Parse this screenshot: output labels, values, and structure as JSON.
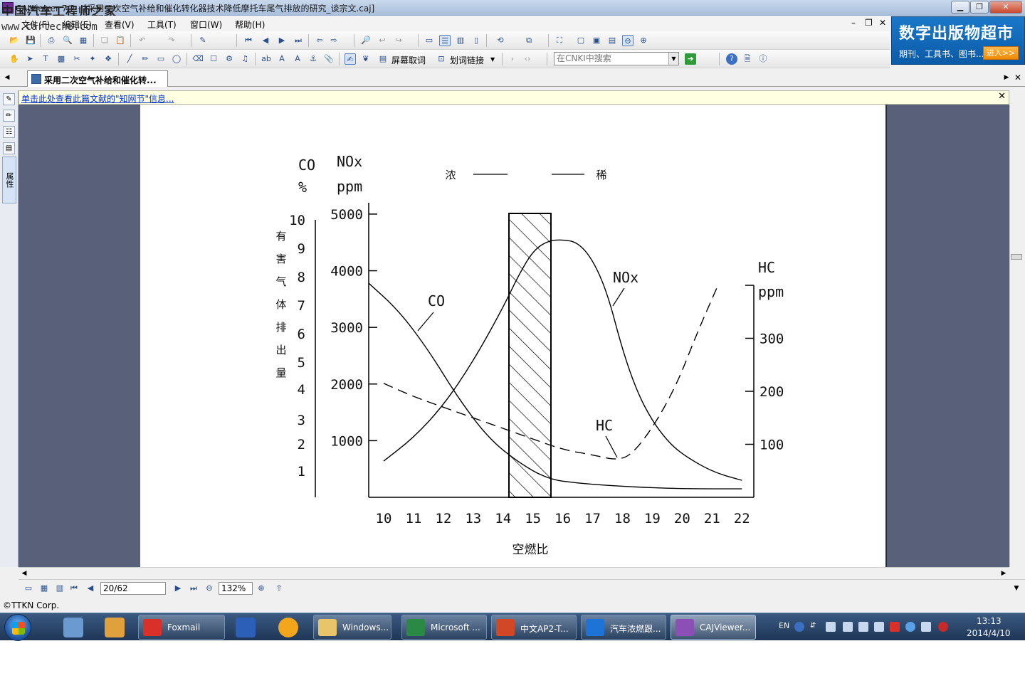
{
  "window": {
    "title": "CAJViewer 7.2 - [采用二次空气补给和催化转化器技术降低摩托车尾气排放的研究_谈宗文.caj]",
    "watermark": "中国汽车工程师之家",
    "watermark_url": "www.cartech8.com"
  },
  "menu": {
    "items": [
      "文件(F)",
      "编辑(E)",
      "查看(V)",
      "工具(T)",
      "窗口(W)",
      "帮助(H)"
    ]
  },
  "toolbar": {
    "screen_capture": "屏幕取词",
    "word_link": "划词链接",
    "search_placeholder": "在CNKI中搜索"
  },
  "ad": {
    "title": "数字出版物超市",
    "subtitle": "期刊、工具书、图书...",
    "enter": "进入>>"
  },
  "tab": {
    "label": "采用二次空气补给和催化转..."
  },
  "infobar": {
    "link": "单击此处查看此篇文献的\"知网节\"信息..."
  },
  "sidepanel": {
    "attr_tab": "属性"
  },
  "nav": {
    "page": "20/62",
    "zoom": "132%"
  },
  "status": {
    "copyright": "©TTKN Corp."
  },
  "taskbar": {
    "tasks": [
      "Foxmail",
      "Windows...",
      "Microsoft ...",
      "中文AP2-T...",
      "汽车浓燃跟...",
      "CAJViewer..."
    ],
    "tray_lang": "EN",
    "time": "13:13",
    "date": "2014/4/10"
  },
  "chart_data": {
    "type": "line",
    "xlabel": "空燃比",
    "x_ticks": [
      10,
      11,
      12,
      13,
      14,
      15,
      16,
      17,
      18,
      19,
      20,
      21,
      22
    ],
    "xlim": [
      9.5,
      22.4
    ],
    "left_axis_co": {
      "label": "CO",
      "unit": "%",
      "ticks": [
        1,
        2,
        3,
        4,
        5,
        6,
        7,
        8,
        9,
        10
      ]
    },
    "left_axis_nox": {
      "label": "NOx",
      "unit": "ppm",
      "ticks": [
        1000,
        2000,
        3000,
        4000,
        5000
      ],
      "ylim": [
        0,
        5200
      ]
    },
    "right_axis_hc": {
      "label": "HC",
      "unit": "ppm",
      "ticks": [
        100,
        200,
        300
      ],
      "ylim": [
        0,
        400
      ]
    },
    "ylabel_vertical": "有害气体排出量",
    "legend_left": "浓",
    "legend_right": "稀",
    "shaded_band": [
      14.1,
      15.6
    ],
    "series": [
      {
        "name": "CO",
        "axis": "nox",
        "style": "solid",
        "x": [
          9.5,
          10.5,
          11.5,
          12.5,
          13.5,
          14.5,
          15.5,
          16.5,
          17.5,
          18.5,
          19.5,
          20.5,
          21.5,
          22.0
        ],
        "y": [
          3780,
          3300,
          2600,
          1750,
          1050,
          620,
          320,
          250,
          210,
          180,
          160,
          150,
          150,
          150
        ]
      },
      {
        "name": "NOx",
        "axis": "nox",
        "style": "solid",
        "x": [
          10.0,
          11.0,
          12.0,
          13.0,
          14.0,
          14.5,
          15.0,
          15.5,
          16.0,
          16.5,
          17.0,
          17.5,
          18.0,
          18.5,
          19.0,
          19.5,
          20.0,
          21.0,
          22.0
        ],
        "y": [
          640,
          1050,
          1620,
          2400,
          3350,
          3900,
          4350,
          4530,
          4550,
          4500,
          4200,
          3600,
          2600,
          1850,
          1350,
          1000,
          760,
          450,
          300
        ]
      },
      {
        "name": "HC",
        "axis": "hc",
        "style": "dashed",
        "x": [
          10.0,
          11.0,
          12.0,
          13.0,
          14.0,
          15.0,
          16.0,
          17.0,
          17.8,
          18.3,
          19.0,
          19.8,
          20.5,
          21.2
        ],
        "y": [
          215,
          190,
          170,
          150,
          130,
          110,
          90,
          80,
          70,
          80,
          130,
          210,
          310,
          400
        ]
      }
    ]
  }
}
